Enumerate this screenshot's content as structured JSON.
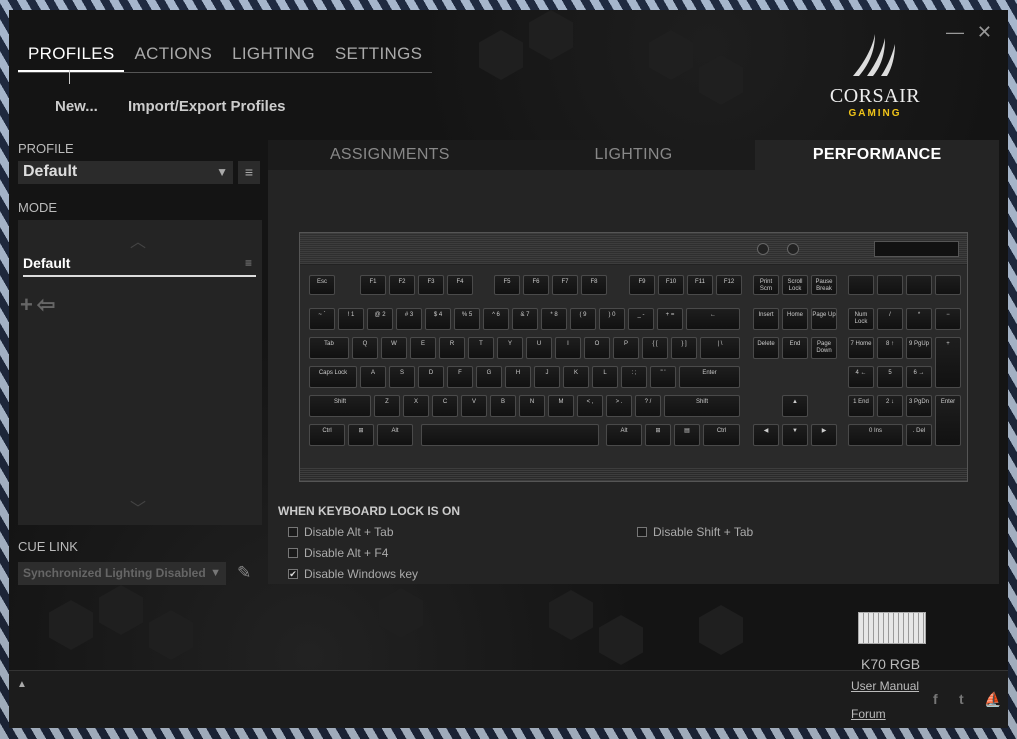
{
  "window": {
    "minimize": "—",
    "close": "✕"
  },
  "top_nav": [
    "PROFILES",
    "ACTIONS",
    "LIGHTING",
    "SETTINGS"
  ],
  "subnav": {
    "new": "New...",
    "import_export": "Import/Export Profiles"
  },
  "logo": {
    "brand": "CORSAIR",
    "sub": "GAMING"
  },
  "sidebar": {
    "profile_label": "PROFILE",
    "profile_value": "Default",
    "mode_label": "MODE",
    "mode_item": "Default",
    "cue_link_label": "CUE LINK",
    "cue_link_value": "Synchronized Lighting Disabled"
  },
  "tabs": [
    "ASSIGNMENTS",
    "LIGHTING",
    "PERFORMANCE"
  ],
  "active_tab": "PERFORMANCE",
  "keyboard_lock": {
    "title": "WHEN KEYBOARD LOCK IS ON",
    "options": [
      {
        "label": "Disable Alt + Tab",
        "checked": false
      },
      {
        "label": "Disable Alt + F4",
        "checked": false
      },
      {
        "label": "Disable Windows key",
        "checked": true
      },
      {
        "label": "Disable Shift + Tab",
        "checked": false
      }
    ]
  },
  "device": {
    "name": "K70 RGB"
  },
  "footer": {
    "user_manual": "User Manual",
    "forum": "Forum",
    "facebook": "f",
    "twitter": "t",
    "corsair": "⛵"
  },
  "keys": {
    "fn_row": [
      "Esc",
      "F1",
      "F2",
      "F3",
      "F4",
      "F5",
      "F6",
      "F7",
      "F8",
      "F9",
      "F10",
      "F11",
      "F12",
      "Print Scrn",
      "Scroll Lock",
      "Pause Break"
    ],
    "num_row": [
      "~ `",
      "! 1",
      "@ 2",
      "# 3",
      "$ 4",
      "% 5",
      "^ 6",
      "& 7",
      "* 8",
      "( 9",
      ") 0",
      "_ -",
      "+ =",
      "←",
      "Insert",
      "Home",
      "Page Up",
      "Num Lock",
      "/",
      "*",
      "−"
    ],
    "q_row": [
      "Tab",
      "Q",
      "W",
      "E",
      "R",
      "T",
      "Y",
      "U",
      "I",
      "O",
      "P",
      "{ [",
      "} ]",
      "| \\",
      "Delete",
      "End",
      "Page Down",
      "7 Home",
      "8 ↑",
      "9 PgUp",
      "+"
    ],
    "a_row": [
      "Caps Lock",
      "A",
      "S",
      "D",
      "F",
      "G",
      "H",
      "J",
      "K",
      "L",
      ": ;",
      "\" '",
      "Enter",
      "4 ←",
      "5",
      "6 →"
    ],
    "z_row": [
      "Shift",
      "Z",
      "X",
      "C",
      "V",
      "B",
      "N",
      "M",
      "< ,",
      "> .",
      "? /",
      "Shift",
      "▲",
      "1 End",
      "2 ↓",
      "3 PgDn",
      "Enter"
    ],
    "space_row": [
      "Ctrl",
      "⊞",
      "Alt",
      "",
      "Alt",
      "⊞",
      "▤",
      "Ctrl",
      "◀",
      "▼",
      "▶",
      "0 Ins",
      ". Del"
    ]
  }
}
